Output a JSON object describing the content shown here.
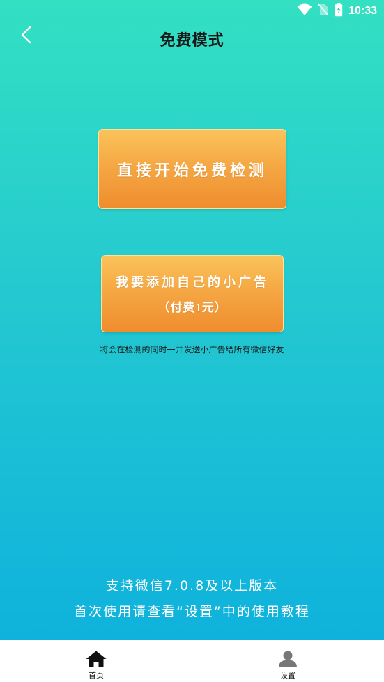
{
  "status_bar": {
    "time": "10:33",
    "icons": [
      "wifi-icon",
      "no-sim-icon",
      "battery-charging-icon"
    ]
  },
  "header": {
    "back_icon": "chevron-left-icon",
    "title": "免费模式"
  },
  "main": {
    "free_button_label": "直接开始免费检测",
    "ad_button_label": "我要添加自己的小广告",
    "ad_button_sublabel_open": "（",
    "ad_button_sublabel_text": "付费",
    "ad_button_sublabel_amount": "1",
    "ad_button_sublabel_unit": "元",
    "ad_button_sublabel_close": "）",
    "note": "将会在检测的同时一并发送小广告给所有微信好友"
  },
  "info": {
    "line1": "支持微信7.0.8及以上版本",
    "line2": "首次使用请查看“设置”中的使用教程"
  },
  "bottom_nav": {
    "items": [
      {
        "label": "首页",
        "icon": "home-icon",
        "active": true
      },
      {
        "label": "设置",
        "icon": "user-icon",
        "active": false
      }
    ]
  },
  "colors": {
    "gradient_top": "#33e0c2",
    "gradient_bottom": "#0fb2dc",
    "button_top": "#fbc35a",
    "button_bottom": "#ef8d2e"
  }
}
